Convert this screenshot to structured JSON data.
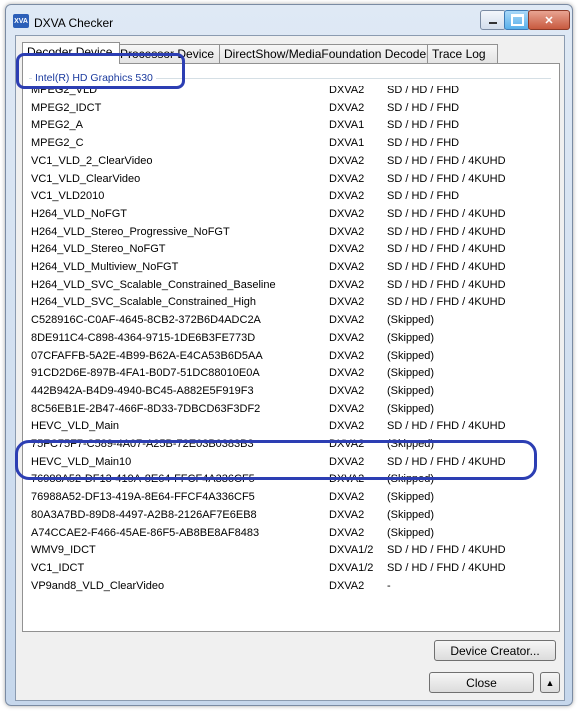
{
  "window": {
    "title": "DXVA Checker",
    "icon_label": "XVA",
    "controls": {
      "minimize": "minimize-icon",
      "maximize": "maximize-icon",
      "close": "close-icon"
    },
    "close_glyph": "✕"
  },
  "tabs": [
    {
      "label": "Decoder Device",
      "active": true
    },
    {
      "label": "Processor Device",
      "active": false
    },
    {
      "label": "DirectShow/MediaFoundation Decoder",
      "active": false
    },
    {
      "label": "Trace Log",
      "active": false
    }
  ],
  "group": {
    "label": "Intel(R) HD Graphics 530"
  },
  "decoders": [
    {
      "name": "MPEG2_VLD",
      "api": "DXVA2",
      "res": "SD / HD / FHD"
    },
    {
      "name": "MPEG2_IDCT",
      "api": "DXVA2",
      "res": "SD / HD / FHD"
    },
    {
      "name": "MPEG2_A",
      "api": "DXVA1",
      "res": "SD / HD / FHD"
    },
    {
      "name": "MPEG2_C",
      "api": "DXVA1",
      "res": "SD / HD / FHD"
    },
    {
      "name": "VC1_VLD_2_ClearVideo",
      "api": "DXVA2",
      "res": "SD / HD / FHD / 4KUHD"
    },
    {
      "name": "VC1_VLD_ClearVideo",
      "api": "DXVA2",
      "res": "SD / HD / FHD / 4KUHD"
    },
    {
      "name": "VC1_VLD2010",
      "api": "DXVA2",
      "res": "SD / HD / FHD"
    },
    {
      "name": "H264_VLD_NoFGT",
      "api": "DXVA2",
      "res": "SD / HD / FHD / 4KUHD"
    },
    {
      "name": "H264_VLD_Stereo_Progressive_NoFGT",
      "api": "DXVA2",
      "res": "SD / HD / FHD / 4KUHD"
    },
    {
      "name": "H264_VLD_Stereo_NoFGT",
      "api": "DXVA2",
      "res": "SD / HD / FHD / 4KUHD"
    },
    {
      "name": "H264_VLD_Multiview_NoFGT",
      "api": "DXVA2",
      "res": "SD / HD / FHD / 4KUHD"
    },
    {
      "name": "H264_VLD_SVC_Scalable_Constrained_Baseline",
      "api": "DXVA2",
      "res": "SD / HD / FHD / 4KUHD"
    },
    {
      "name": "H264_VLD_SVC_Scalable_Constrained_High",
      "api": "DXVA2",
      "res": "SD / HD / FHD / 4KUHD"
    },
    {
      "name": "C528916C-C0AF-4645-8CB2-372B6D4ADC2A",
      "api": "DXVA2",
      "res": "(Skipped)"
    },
    {
      "name": "8DE911C4-C898-4364-9715-1DE6B3FE773D",
      "api": "DXVA2",
      "res": "(Skipped)"
    },
    {
      "name": "07CFAFFB-5A2E-4B99-B62A-E4CA53B6D5AA",
      "api": "DXVA2",
      "res": "(Skipped)"
    },
    {
      "name": "91CD2D6E-897B-4FA1-B0D7-51DC88010E0A",
      "api": "DXVA2",
      "res": "(Skipped)"
    },
    {
      "name": "442B942A-B4D9-4940-BC45-A882E5F919F3",
      "api": "DXVA2",
      "res": "(Skipped)"
    },
    {
      "name": "8C56EB1E-2B47-466F-8D33-7DBCD63F3DF2",
      "api": "DXVA2",
      "res": "(Skipped)"
    },
    {
      "name": "HEVC_VLD_Main",
      "api": "DXVA2",
      "res": "SD / HD / FHD / 4KUHD"
    },
    {
      "name": "75FC75F7-C589-4A07-A25B-72E03B0383B3",
      "api": "DXVA2",
      "res": "(Skipped)"
    },
    {
      "name": "HEVC_VLD_Main10",
      "api": "DXVA2",
      "res": "SD / HD / FHD / 4KUHD"
    },
    {
      "name": "76988A52-DF13-419A-8E64-FFCF4A336CF5",
      "api": "DXVA2",
      "res": "(Skipped)"
    },
    {
      "name": "76988A52-DF13-419A-8E64-FFCF4A336CF5",
      "api": "DXVA2",
      "res": "(Skipped)"
    },
    {
      "name": "80A3A7BD-89D8-4497-A2B8-2126AF7E6EB8",
      "api": "DXVA2",
      "res": "(Skipped)"
    },
    {
      "name": "A74CCAE2-F466-45AE-86F5-AB8BE8AF8483",
      "api": "DXVA2",
      "res": "(Skipped)"
    },
    {
      "name": "WMV9_IDCT",
      "api": "DXVA1/2",
      "res": "SD / HD / FHD / 4KUHD"
    },
    {
      "name": "VC1_IDCT",
      "api": "DXVA1/2",
      "res": "SD / HD / FHD / 4KUHD"
    },
    {
      "name": "VP9and8_VLD_ClearVideo",
      "api": "DXVA2",
      "res": "-"
    }
  ],
  "buttons": {
    "device_creator": "Device Creator...",
    "close": "Close",
    "expand_glyph": "▲"
  },
  "annotation_color": "#2c3eb3"
}
